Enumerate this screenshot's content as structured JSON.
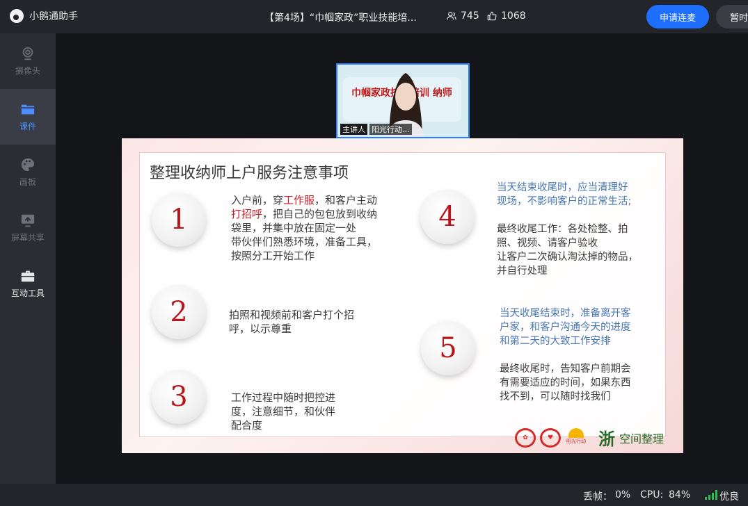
{
  "app": {
    "name": "小鹅通助手"
  },
  "header": {
    "title": "【第4场】“巾帼家政”职业技能培...",
    "viewers": "745",
    "likes": "1068",
    "apply_button": "申请连麦",
    "pause_button": "暂时"
  },
  "sidebar": {
    "items": [
      {
        "label": "摄像头",
        "icon": "camera-icon"
      },
      {
        "label": "课件",
        "icon": "folder-icon"
      },
      {
        "label": "画板",
        "icon": "palette-icon"
      },
      {
        "label": "屏幕共享",
        "icon": "screen-share-icon"
      },
      {
        "label": "互动工具",
        "icon": "toolbox-icon"
      }
    ]
  },
  "camera": {
    "banner": "巾帼家政技能培训 纳师",
    "role_tag": "主讲人",
    "presenter_name": "阳光行动..."
  },
  "slide": {
    "title": "整理收纳师上户服务注意事项",
    "items": [
      {
        "num": "1",
        "line1_a": "入户前，穿",
        "line1_red": "工作服",
        "line1_b": "，和客户主动",
        "line2_red": "打招呼",
        "line2_b": "，把自己的包包放到收纳",
        "line3": "袋里，并集中放在固定一处",
        "line4": "带伙伴们熟悉环境，准备工具，",
        "line5": "按照分工开始工作"
      },
      {
        "num": "2",
        "line1": "拍照和视频前和客户打个招",
        "line2": "呼，以示尊重"
      },
      {
        "num": "3",
        "line1": "工作过程中随时把控进",
        "line2": "度，注意细节，和伙伴",
        "line3": "配合度"
      },
      {
        "num": "4",
        "blue1": "当天结束收尾时，应当清理好",
        "blue2": "现场，不影响客户的正常生活;",
        "line1": "最终收尾工作：各处检整、拍",
        "line2": "照、视频、请客户验收",
        "line3": "让客户二次确认淘汰掉的物品，",
        "line4": "并自行处理"
      },
      {
        "num": "5",
        "blue1": "当天收尾结束时，准备离开客",
        "blue2": "户家，和客户沟通今天的进度",
        "blue3": "和第二天的大致工作安排",
        "line1": "最终收尾时，告知客户前期会",
        "line2": "有需要适应的时间，如果东西",
        "line3": "找不到，可以随时找我们"
      }
    ],
    "logos": {
      "sun_text": "阳光行动",
      "zhe": "浙",
      "brand": "空间整理"
    }
  },
  "status": {
    "frame_drop_label": "丢帧：",
    "frame_drop_value": "0%",
    "cpu_label": "CPU:",
    "cpu_value": "84%",
    "network": "优良"
  },
  "colors": {
    "accent": "#1e6fff",
    "active_tab": "#4d8dff",
    "slide_red": "#b8151b",
    "signal": "#29c24a"
  }
}
